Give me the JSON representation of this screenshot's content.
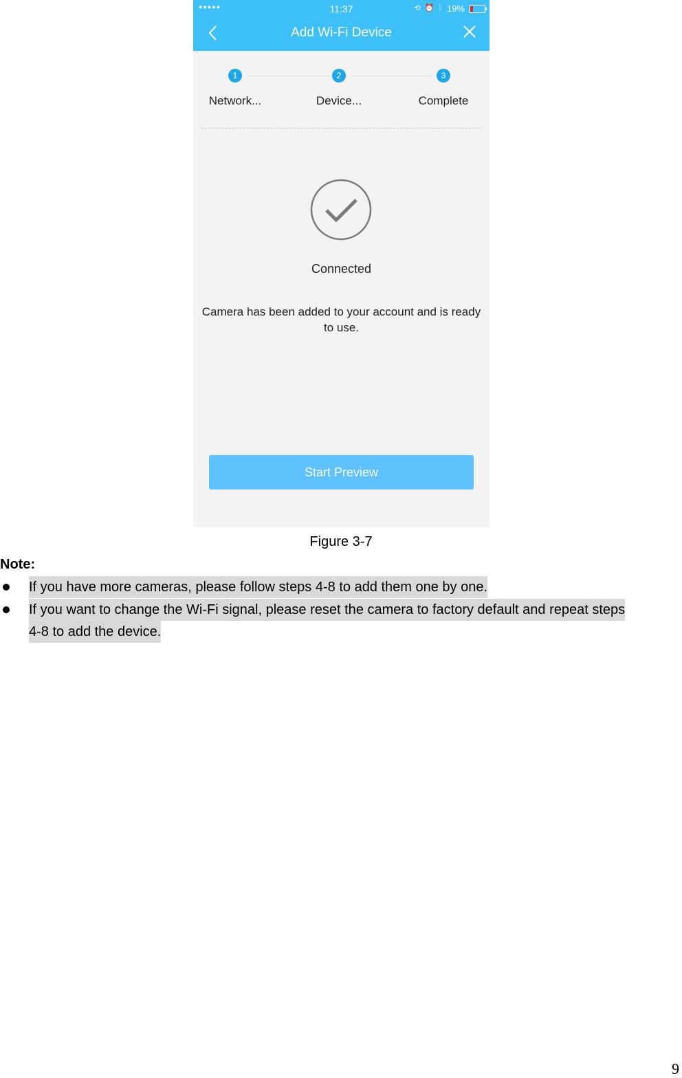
{
  "phone": {
    "status_bar": {
      "signal": "●●●●●",
      "time": "11:37",
      "battery_percent": "19%",
      "battery_level": 0.19,
      "icons": [
        "orientation-lock-icon",
        "alarm-icon",
        "bluetooth-icon",
        "battery-icon"
      ]
    },
    "nav": {
      "title": "Add Wi-Fi Device",
      "back_icon": "chevron-left-icon",
      "close_icon": "close-icon"
    },
    "steps": [
      {
        "num": "1",
        "label": "Network..."
      },
      {
        "num": "2",
        "label": "Device..."
      },
      {
        "num": "3",
        "label": "Complete"
      }
    ],
    "status_icon": "checkmark-circle-icon",
    "status_title": "Connected",
    "description": "Camera has been added to your account and is ready to use.",
    "start_button": "Start Preview",
    "colors": {
      "accent": "#3dbff8",
      "step": "#1ea7e8",
      "button": "#5fc1fb",
      "background": "#f3f3f3"
    }
  },
  "document": {
    "caption": "Figure 3-7",
    "note_title": "Note:",
    "notes": [
      "If you have more cameras, please follow steps 4-8 to add them one by one.",
      "If you want to change the Wi-Fi signal, please reset the camera to factory default and repeat steps",
      "4-8 to add the device."
    ],
    "page_number": "9"
  }
}
